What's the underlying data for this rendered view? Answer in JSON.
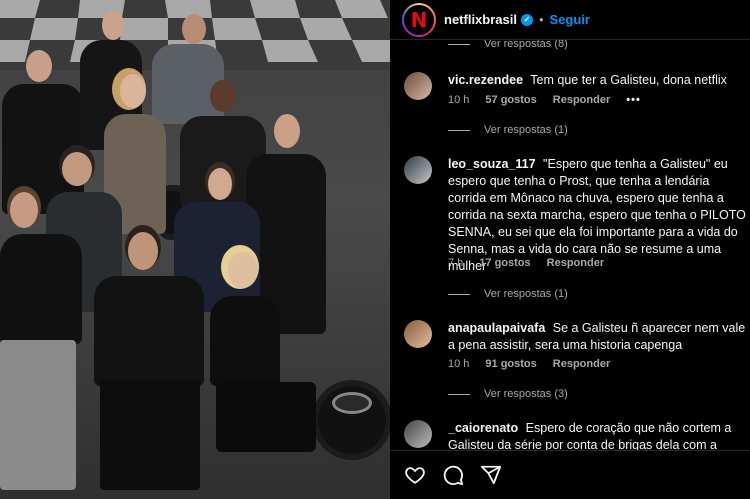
{
  "post": {
    "username": "netflixbrasil",
    "avatar_letter": "N",
    "verified_mark": "✓",
    "separator": "•",
    "follow_label": "Seguir",
    "brand_color": "#e50914",
    "accent_color": "#0095f6"
  },
  "top_partial": {
    "label": "Ver respostas (8)"
  },
  "comments": [
    {
      "user": "vic.rezendee",
      "text": "Tem que ter a Galisteu, dona netflix",
      "time": "10 h",
      "likes": "57 gostos",
      "reply": "Responder",
      "more": "•••",
      "replies": "Ver respostas (1)"
    },
    {
      "user": "leo_souza_117",
      "text": "\"Espero que tenha a Galisteu\" eu espero que tenha o Prost, que tenha a lendária corrida em Mônaco na chuva, espero que tenha a corrida na sexta marcha, espero que tenha o PILOTO SENNA, eu sei que ela foi importante para a vida do Senna, mas a vida do cara não se resume a uma mulher",
      "time": "7 h",
      "likes": "17 gostos",
      "reply": "Responder",
      "replies": "Ver respostas (1)"
    },
    {
      "user": "anapaulapaivafa",
      "text": "Se a Galisteu ñ aparecer nem vale a pena assistir, sera uma historia capenga",
      "time": "10 h",
      "likes": "91 gostos",
      "reply": "Responder",
      "replies": "Ver respostas (3)"
    },
    {
      "user": "_caiorenato",
      "text": "Espero de coração que não cortem a Galisteu da série por conta de brigas dela com a Família Senna... Vai"
    }
  ],
  "actions": {
    "icons": [
      "heart-icon",
      "comment-icon",
      "share-icon"
    ]
  }
}
